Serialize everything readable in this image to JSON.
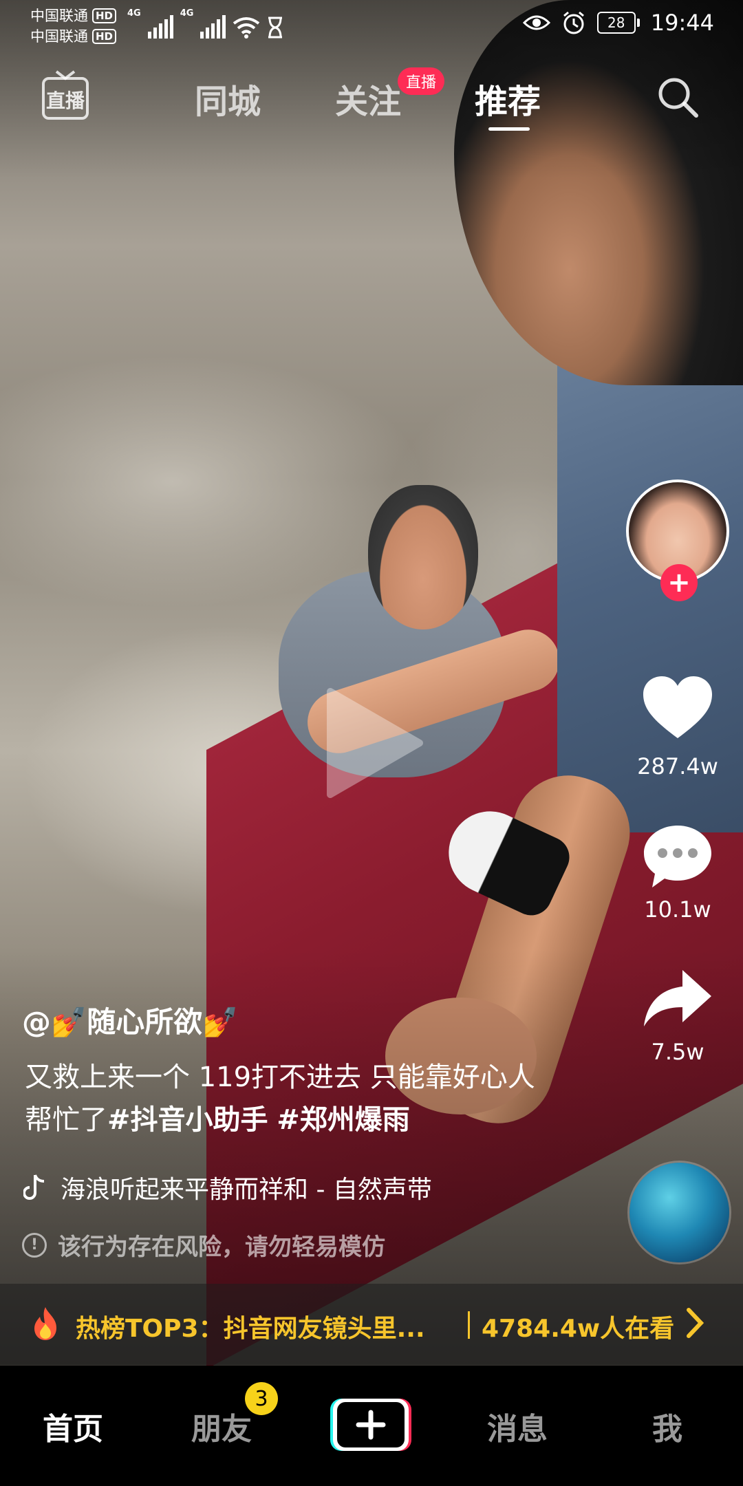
{
  "status_bar": {
    "carrier_1": "中国联通",
    "carrier_2": "中国联通",
    "hd_label": "HD",
    "network_1": "4G",
    "network_2": "4G",
    "battery": "28",
    "time": "19:44"
  },
  "top_nav": {
    "live_icon_label": "直播",
    "tabs": [
      "同城",
      "关注",
      "推荐"
    ],
    "active_tab": "推荐",
    "follow_live_badge": "直播"
  },
  "video": {
    "author": "@💅随心所欲💅",
    "caption_text": "又救上来一个 119打不进去 只能靠好心人帮忙了",
    "hashtags": [
      "#抖音小助手",
      "#郑州爆雨"
    ],
    "music": "海浪听起来平静而祥和 - 自然声带",
    "risk_warning": "该行为存在风险，请勿轻易模仿"
  },
  "actions": {
    "likes": "287.4w",
    "comments": "10.1w",
    "shares": "7.5w"
  },
  "hot_bar": {
    "text": "热榜TOP3：抖音网友镜头里...",
    "viewers": "4784.4w人在看"
  },
  "bottom_nav": {
    "items": [
      "首页",
      "朋友",
      "消息",
      "我"
    ],
    "active": "首页",
    "friends_badge": "3"
  },
  "colors": {
    "accent_red": "#fe2c55",
    "hot_yellow": "#f7c52c",
    "badge_yellow": "#f7d21a"
  }
}
